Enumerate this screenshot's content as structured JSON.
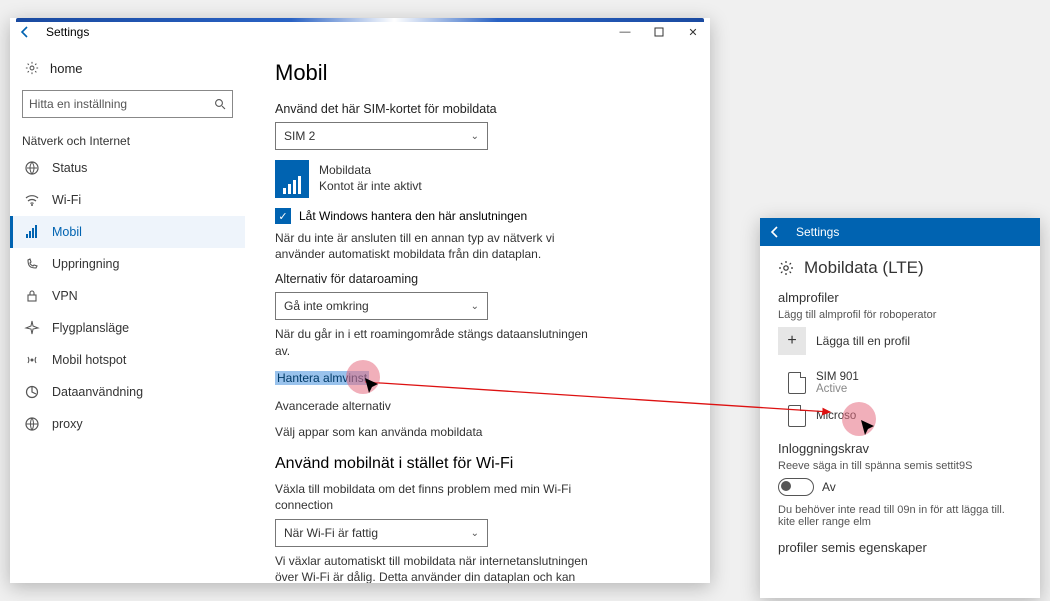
{
  "win1": {
    "title": "Settings",
    "sidebar": {
      "home": "home",
      "search_placeholder": "Hitta en inställning",
      "section": "Nätverk och Internet",
      "items": [
        {
          "label": "Status",
          "icon": "status-icon"
        },
        {
          "label": "Wi-Fi",
          "icon": "wifi-icon"
        },
        {
          "label": "Mobil",
          "icon": "signal-icon",
          "active": true
        },
        {
          "label": "Uppringning",
          "icon": "dialup-icon"
        },
        {
          "label": "VPN",
          "icon": "vpn-icon"
        },
        {
          "label": "Flygplansläge",
          "icon": "airplane-icon"
        },
        {
          "label": "Mobil hotspot",
          "icon": "hotspot-icon"
        },
        {
          "label": "Dataanvändning",
          "icon": "datausage-icon"
        },
        {
          "label": "proxy",
          "icon": "proxy-icon"
        }
      ]
    },
    "content": {
      "h1": "Mobil",
      "sim_label": "Använd det här SIM-kortet för mobildata",
      "sim_select": "SIM 2",
      "mobiledata_title": "Mobildata",
      "mobiledata_sub": "Kontot är inte aktivt",
      "let_windows": "Låt Windows hantera den här anslutningen",
      "auto_text": "När du inte är ansluten till en annan typ av nätverk vi använder automatiskt mobildata från din dataplan.",
      "roaming_label": "Alternativ för dataroaming",
      "roaming_select": "Gå inte omkring",
      "roaming_text": "När du går in i ett roamingområde stängs dataanslutningen av.",
      "link_manage": "Hantera almvinst",
      "link_adv": "Avancerade alternativ",
      "link_apps": "Välj appar som kan använda mobildata",
      "h2": "Använd mobilnät i stället för Wi-Fi",
      "fallback_label": "Växla till mobildata om det finns problem med min Wi-Fi connection",
      "fallback_select": "När Wi-Fi är fattig",
      "fallback_text": "Vi växlar automatiskt till mobildata när internetanslutningen över Wi-Fi är dålig. Detta använder din dataplan och kan medföra avgifter för"
    }
  },
  "win2": {
    "title": "Settings",
    "h1": "Mobildata (LTE)",
    "profiles_h": "almprofiler",
    "profiles_sub": "Lägg till almprofil för roboperator",
    "add_profile": "Lägga till en profil",
    "sim1_name": "SIM 901",
    "sim1_status": "Active",
    "sim2_name": "Microso",
    "login_h": "Inloggningskrav",
    "login_sub": "Reeve säga in till spänna semis settit9S",
    "toggle_label": "Av",
    "login_text": "Du behöver inte read till 09n in för att lägga till. kite eller range elm",
    "bottom": "profiler semis egenskaper"
  }
}
